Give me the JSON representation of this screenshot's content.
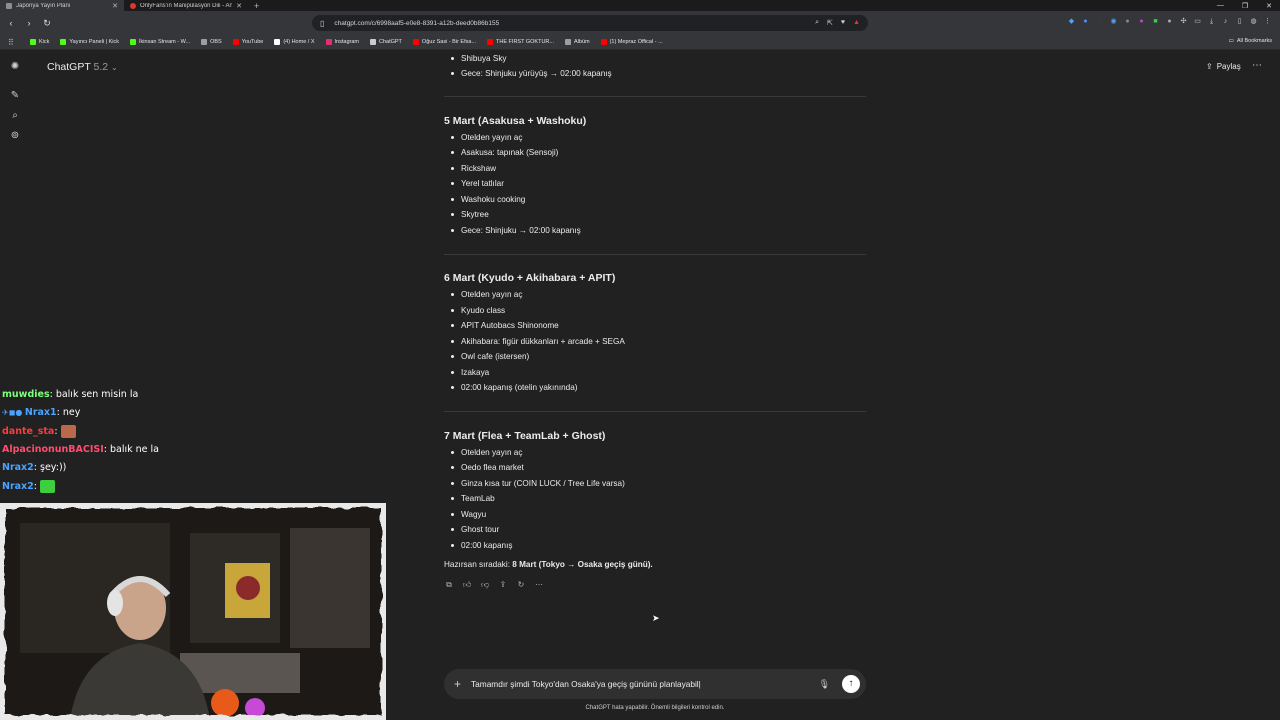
{
  "browser": {
    "tabs": [
      {
        "label": "Japonya Yayın Planı",
        "active": true
      },
      {
        "label": "OnlyFans'ın Manipülasyon Dili - Ana...",
        "active": false
      }
    ],
    "url": "chatgpt.com/c/6998aaf5-e0e8-8391-a12b-deed0b86b155",
    "bookmarks": [
      {
        "label": "Kick",
        "color": "#53fc18"
      },
      {
        "label": "Yayıncı Paneli | Kick",
        "color": "#53fc18"
      },
      {
        "label": "İkinsan Stream - W...",
        "color": "#53fc18"
      },
      {
        "label": "OBS",
        "color": "#9e9e9e"
      },
      {
        "label": "YouTube",
        "color": "#ff0000"
      },
      {
        "label": "(4) Home / X",
        "color": "#ffffff"
      },
      {
        "label": "Instagram",
        "color": "#e1306c"
      },
      {
        "label": "ChatGPT",
        "color": "#cccccc"
      },
      {
        "label": "Oğuz Sasi - Bir Efsa...",
        "color": "#ff0000"
      },
      {
        "label": "THE FIRST GOKTUR...",
        "color": "#ff0000"
      },
      {
        "label": "Albüm",
        "color": "#9e9e9e"
      },
      {
        "label": "(1) Mepraz Offical - ...",
        "color": "#ff0000"
      }
    ],
    "all_bookmarks": "All Bookmarks"
  },
  "app": {
    "model": "ChatGPT",
    "model_version": "5.2",
    "share_label": "Paylaş"
  },
  "conversation": {
    "top_items": [
      "Shibuya Sky",
      "Gece: Shinjuku yürüyüş → 02:00 kapanış"
    ],
    "days": [
      {
        "title": "5 Mart (Asakusa + Washoku)",
        "items": [
          "Otelden yayın aç",
          "Asakusa: tapınak (Sensoji)",
          "Rickshaw",
          "Yerel tatlılar",
          "Washoku cooking",
          "Skytree",
          "Gece: Shinjuku → 02:00 kapanış"
        ]
      },
      {
        "title": "6 Mart (Kyudo + Akihabara + APIT)",
        "items": [
          "Otelden yayın aç",
          "Kyudo class",
          "APIT Autobacs Shinonome",
          "Akihabara: figür dükkanları + arcade + SEGA",
          "Owl cafe (istersen)",
          "Izakaya",
          "02:00 kapanış (otelin yakınında)"
        ]
      },
      {
        "title": "7 Mart (Flea + TeamLab + Ghost)",
        "items": [
          "Otelden yayın aç",
          "Oedo flea market",
          "Ginza kısa tur (COIN LUCK / Tree Life varsa)",
          "TeamLab",
          "Wagyu",
          "Ghost tour",
          "02:00 kapanış"
        ]
      }
    ],
    "next_prefix": "Hazırsan sıradaki: ",
    "next_bold": "8 Mart (Tokyo → Osaka geçiş günü)."
  },
  "composer": {
    "value": "Tamamdır şimdi Tokyo'dan Osaka'ya geçiş gününü planlayabil|",
    "disclaimer": "ChatGPT hata yapabilir. Önemli bilgileri kontrol edin."
  },
  "stream_chat": [
    {
      "user": "muwdies",
      "color": "#7cff7a",
      "text": ": balık sen misin la",
      "emote": false,
      "badges": false
    },
    {
      "user": "Nrax1",
      "color": "#4aa3ff",
      "text": ": ney",
      "emote": false,
      "badges": true
    },
    {
      "user": "dante_sta",
      "color": "#ff3b3b",
      "text": ":",
      "emote": true,
      "emote_color": "#b86a4a",
      "badges": false
    },
    {
      "user": "AlpacinonunBACISI",
      "color": "#ff4d6d",
      "text": ": balık ne la",
      "emote": false,
      "badges": false
    },
    {
      "user": "Nrax2",
      "color": "#4aa3ff",
      "text": ": şey:))",
      "emote": false,
      "badges": false
    },
    {
      "user": "Nrax2",
      "color": "#4aa3ff",
      "text": ":",
      "emote": true,
      "emote_color": "#3ecf3e",
      "badges": false
    }
  ]
}
